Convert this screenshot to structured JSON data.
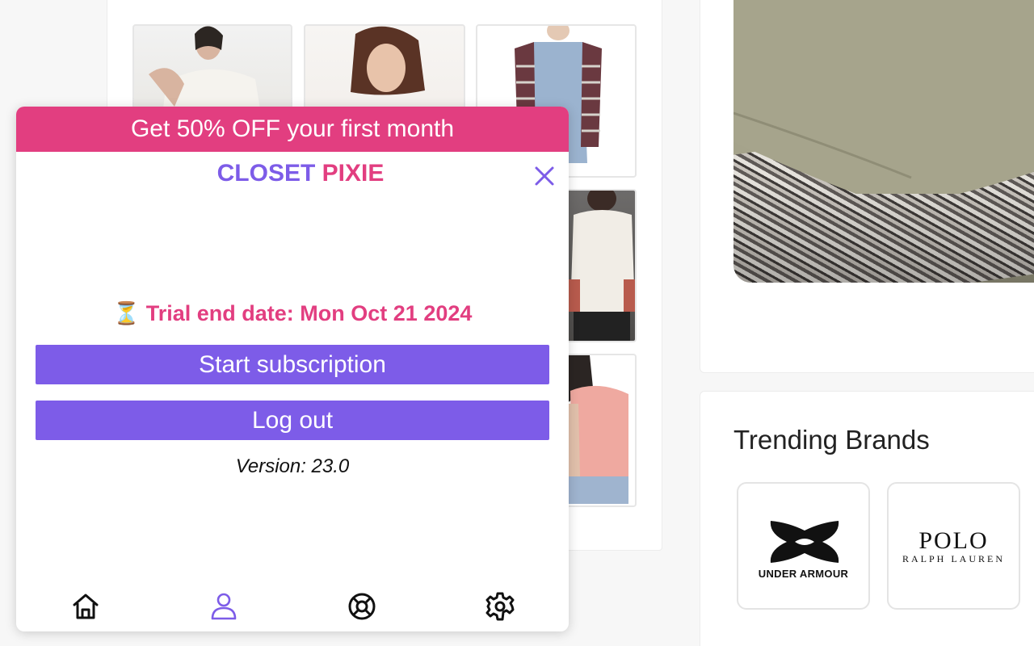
{
  "popup": {
    "promo_banner": "Get 50% OFF your first month",
    "brand_word1": "CLOSET",
    "brand_word2": "PIXIE",
    "trial_icon": "⏳",
    "trial_text": "Trial end date: Mon Oct 21 2024",
    "start_subscription_label": "Start subscription",
    "logout_label": "Log out",
    "version_text": "Version: 23.0",
    "nav": [
      {
        "name": "home",
        "icon": "home-icon"
      },
      {
        "name": "profile",
        "icon": "user-icon",
        "active": true
      },
      {
        "name": "wheel",
        "icon": "wheel-icon"
      },
      {
        "name": "settings",
        "icon": "gear-icon"
      }
    ]
  },
  "background": {
    "trending_brands_title": "Trending Brands",
    "brands": [
      {
        "name": "UNDER ARMOUR"
      },
      {
        "name_line1": "POLO",
        "name_line2": "RALPH LAUREN"
      }
    ]
  },
  "colors": {
    "accent_purple": "#7d5ce8",
    "accent_pink": "#e23e80"
  }
}
